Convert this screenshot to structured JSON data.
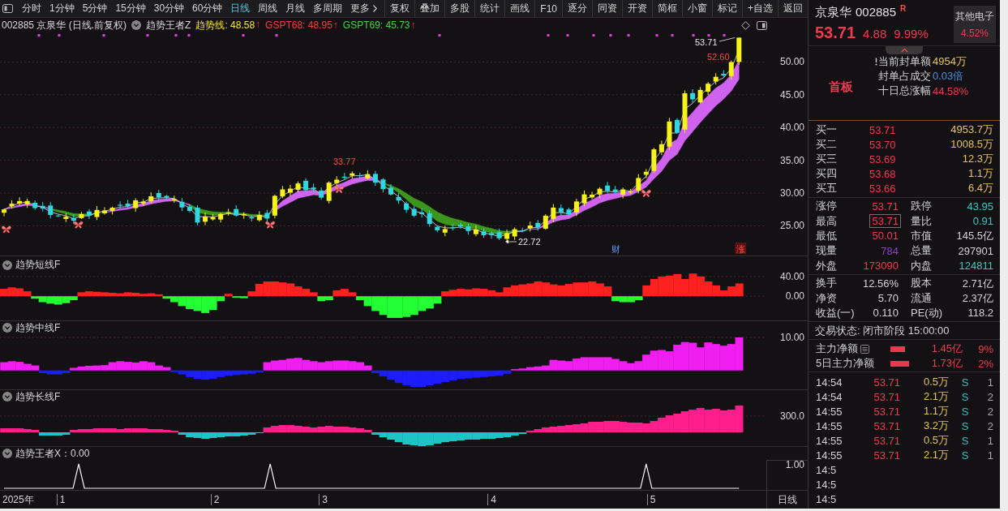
{
  "toolbar": {
    "periods": [
      {
        "label": "分时",
        "selected": false
      },
      {
        "label": "1分钟",
        "selected": false
      },
      {
        "label": "5分钟",
        "selected": false
      },
      {
        "label": "15分钟",
        "selected": false
      },
      {
        "label": "30分钟",
        "selected": false
      },
      {
        "label": "60分钟",
        "selected": false
      },
      {
        "label": "日线",
        "selected": true
      },
      {
        "label": "周线",
        "selected": false
      },
      {
        "label": "月线",
        "selected": false
      },
      {
        "label": "多周期",
        "selected": false
      }
    ],
    "more_menu": "更多",
    "actions": [
      "复权",
      "叠加",
      "多股",
      "统计",
      "画线",
      "F10",
      "逐分",
      "同资",
      "开资",
      "简框",
      "小窗",
      "标记",
      "+自选",
      "返回"
    ]
  },
  "chart_header": {
    "title": "002885 京泉华 (日线.前复权)",
    "indicator": "趋势王者Z",
    "readings": [
      {
        "text": "趋势线: 48.58",
        "arrow": "↑",
        "color": "#f2e33a"
      },
      {
        "text": "GSPT68: 48.95",
        "arrow": "↑",
        "color": "#ff3b3b"
      },
      {
        "text": "GSPT69: 45.73",
        "arrow": "↑",
        "color": "#3bd83b"
      }
    ]
  },
  "main_chart": {
    "price_axis": [
      "50.00",
      "45.00",
      "40.00",
      "35.00",
      "30.00",
      "25.00"
    ],
    "peak_label": "33.77",
    "trough_label": "22.72",
    "high_label": "53.71",
    "close_label": "52.60",
    "event_markers": [
      {
        "text": "财",
        "kind": "finance"
      },
      {
        "text": "涨",
        "kind": "limit"
      }
    ]
  },
  "short_trend_pane": {
    "chart_data": {
      "type": "bar",
      "title": "趋势短线F",
      "values": [
        15,
        18,
        16,
        10,
        -5,
        -12,
        -15,
        -17,
        -14,
        -8,
        8,
        10,
        9,
        8,
        7,
        6,
        8,
        7,
        5,
        6,
        4,
        -5,
        -12,
        -20,
        -26,
        -30,
        -34,
        -28,
        -10,
        5,
        -3,
        -4,
        10,
        25,
        30,
        30,
        28,
        26,
        20,
        15,
        8,
        -10,
        -8,
        12,
        15,
        8,
        -8,
        -20,
        -30,
        -38,
        -44,
        -44,
        -42,
        -38,
        -30,
        -25,
        -15,
        10,
        13,
        15,
        14,
        16,
        15,
        12,
        8,
        18,
        22,
        24,
        26,
        30,
        28,
        24,
        22,
        25,
        28,
        28,
        30,
        26,
        20,
        -10,
        -12,
        -12,
        -8,
        22,
        35,
        40,
        42,
        45,
        35,
        46,
        40,
        30,
        22,
        12,
        20,
        26,
        null,
        null,
        null
      ],
      "ylim": [
        -49,
        81
      ],
      "yticks": [
        {
          "value": 40,
          "label": "40.00"
        },
        {
          "value": 0,
          "label": "0.00"
        }
      ]
    }
  },
  "mid_trend_pane": {
    "title": "趋势中线F",
    "axis_label": "10.00"
  },
  "long_trend_pane": {
    "title": "趋势长线F",
    "axis_label": "300.0"
  },
  "signal_pane": {
    "title": "趋势王者X：0.00",
    "axis_label": "1.00"
  },
  "time_axis": {
    "year": "2025年",
    "months": [
      "1",
      "2",
      "3",
      "4",
      "5"
    ],
    "period": "日线"
  },
  "quote": {
    "name": "京泉华",
    "code": "002885",
    "flag": "R",
    "price": "53.71",
    "change": "4.88",
    "change_pct": "9.99%",
    "sector": {
      "name": "其他电子",
      "change": "4.52%"
    }
  },
  "limit_info": {
    "tag": "首板",
    "rows": [
      {
        "label": "当前封单额",
        "value": "4954万",
        "color": "#e6c35c",
        "kind": "alert"
      },
      {
        "label": "封单占成交",
        "value": "0.03倍",
        "color": "#4a8fe0",
        "kind": "plain"
      },
      {
        "label": "十日总涨幅",
        "value": "44.58%",
        "color": "#ec3b4f",
        "kind": "plain"
      }
    ]
  },
  "order_book": [
    {
      "label": "买一",
      "price": "53.71",
      "volume": "4953.7万"
    },
    {
      "label": "买二",
      "price": "53.70",
      "volume": "1008.5万"
    },
    {
      "label": "买三",
      "price": "53.69",
      "volume": "12.3万"
    },
    {
      "label": "买四",
      "price": "53.68",
      "volume": "1.1万"
    },
    {
      "label": "买五",
      "price": "53.66",
      "volume": "6.4万"
    }
  ],
  "stats_primary": [
    {
      "label": "涨停",
      "value": "53.71",
      "color": "#ec3b4f",
      "outlined": false
    },
    {
      "label": "跌停",
      "value": "43.95",
      "color": "#3cc8c0",
      "outlined": false
    },
    {
      "label": "最高",
      "value": "53.71",
      "color": "#ec3b4f",
      "outlined": true
    },
    {
      "label": "量比",
      "value": "0.91",
      "color": "#3cc8c0",
      "outlined": false
    },
    {
      "label": "最低",
      "value": "50.01",
      "color": "#ec3b4f",
      "outlined": false
    },
    {
      "label": "市值",
      "value": "145.5亿",
      "color": "#d2d2d2",
      "outlined": false
    },
    {
      "label": "现量",
      "value": "784",
      "color": "#9040d0",
      "outlined": false
    },
    {
      "label": "总量",
      "value": "297901",
      "color": "#d2d2d2",
      "outlined": false
    },
    {
      "label": "外盘",
      "value": "173090",
      "color": "#ec3b4f",
      "outlined": false
    },
    {
      "label": "内盘",
      "value": "124811",
      "color": "#3cc8c0",
      "outlined": false
    }
  ],
  "stats_secondary": [
    {
      "label": "换手",
      "value": "12.56%"
    },
    {
      "label": "股本",
      "value": "2.71亿"
    },
    {
      "label": "净资",
      "value": "5.70"
    },
    {
      "label": "流通",
      "value": "2.37亿"
    },
    {
      "label": "收益(一)",
      "value": "0.110"
    },
    {
      "label": "PE(动)",
      "value": "118.2"
    }
  ],
  "trade_status": "交易状态: 闭市阶段 15:00:00",
  "capital_flow": [
    {
      "label": "主力净额",
      "kind": "detail",
      "amount": "1.45亿",
      "share": "9%"
    },
    {
      "label": "5日主力净额",
      "kind": "plain",
      "amount": "1.73亿",
      "share": "2%"
    }
  ],
  "trades": [
    {
      "time": "14:54",
      "price": "53.71",
      "volume": "0.5万",
      "side": "S",
      "count": "1"
    },
    {
      "time": "14:54",
      "price": "53.71",
      "volume": "2.1万",
      "side": "S",
      "count": "2"
    },
    {
      "time": "14:55",
      "price": "53.71",
      "volume": "1.1万",
      "side": "S",
      "count": "2"
    },
    {
      "time": "14:55",
      "price": "53.71",
      "volume": "3.2万",
      "side": "S",
      "count": "2"
    },
    {
      "time": "14:55",
      "price": "53.71",
      "volume": "0.5万",
      "side": "S",
      "count": "1"
    },
    {
      "time": "14:55",
      "price": "53.71",
      "volume": "2.1万",
      "side": "S",
      "count": "1"
    },
    {
      "time": "14:5"
    },
    {
      "time": "14:5"
    },
    {
      "time": "14:5"
    }
  ]
}
